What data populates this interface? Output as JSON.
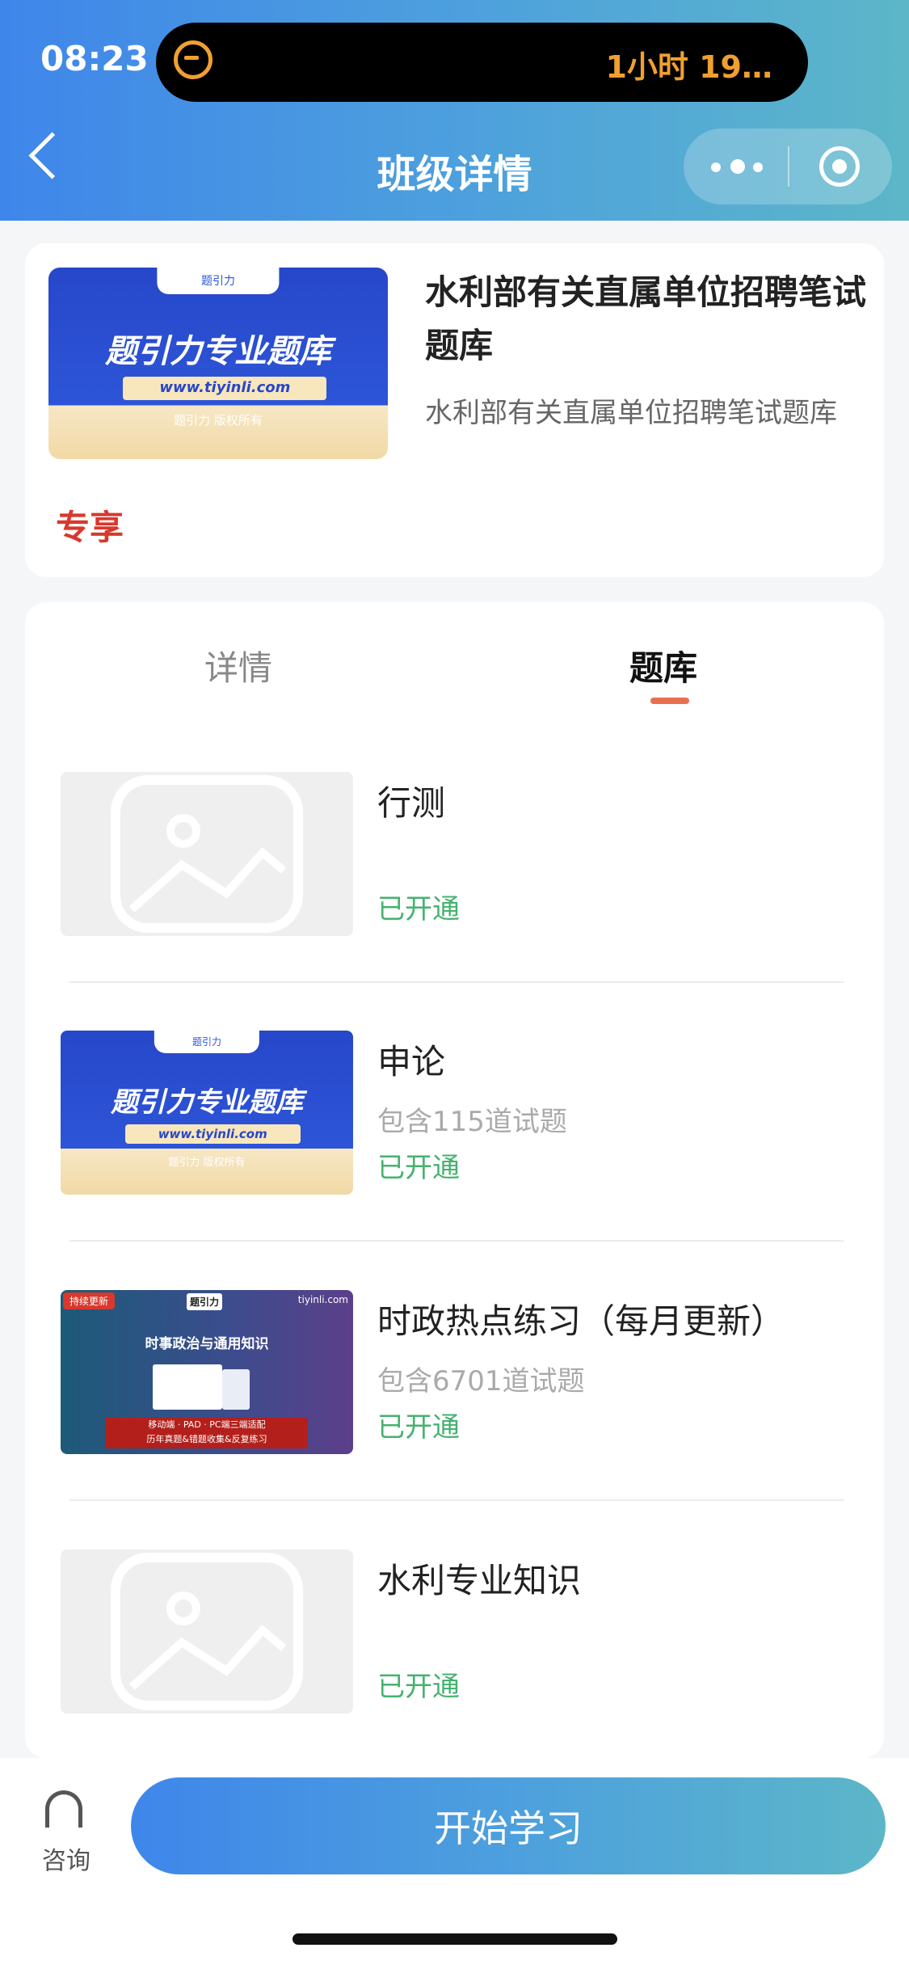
{
  "status_bar": {
    "time": "08:23",
    "activity": "1小时 19…"
  },
  "nav": {
    "title": "班级详情",
    "menu_icon": "more-dots-icon",
    "close_icon": "target-circle-icon"
  },
  "course": {
    "title": "水利部有关直属单位招聘笔试题库",
    "subtitle": "水利部有关直属单位招聘笔试题库",
    "tag": "专享",
    "cover": {
      "brand": "题引力",
      "main": "题引力专业题库",
      "url": "www.tiyinli.com",
      "copyright": "题引力 版权所有"
    }
  },
  "tabs": [
    {
      "label": "详情",
      "active": false
    },
    {
      "label": "题库",
      "active": true
    }
  ],
  "banks": [
    {
      "title": "行测",
      "count": "",
      "status": "已开通",
      "thumb": "placeholder"
    },
    {
      "title": "申论",
      "count": "包含115道试题",
      "status": "已开通",
      "thumb": "brand-cover"
    },
    {
      "title": "时政热点练习（每月更新）",
      "count": "包含6701道试题",
      "status": "已开通",
      "thumb": "current-affairs-cover",
      "cover": {
        "badge": "持续更新",
        "logo": "题引力",
        "site": "tiyinli.com",
        "headline": "时事政治与通用知识",
        "line1": "移动端 · PAD · PC端三端适配",
        "line2": "历年真题&错题收集&反复练习"
      }
    },
    {
      "title": "水利专业知识",
      "count": "",
      "status": "已开通",
      "thumb": "placeholder"
    }
  ],
  "bottom": {
    "consult_label": "咨询",
    "start_label": "开始学习"
  },
  "colors": {
    "accent_start": "#3f86ea",
    "accent_end": "#5cb6c8",
    "status_green": "#45b26f",
    "tag_red": "#d9382d",
    "tab_underline": "#e8704e"
  }
}
